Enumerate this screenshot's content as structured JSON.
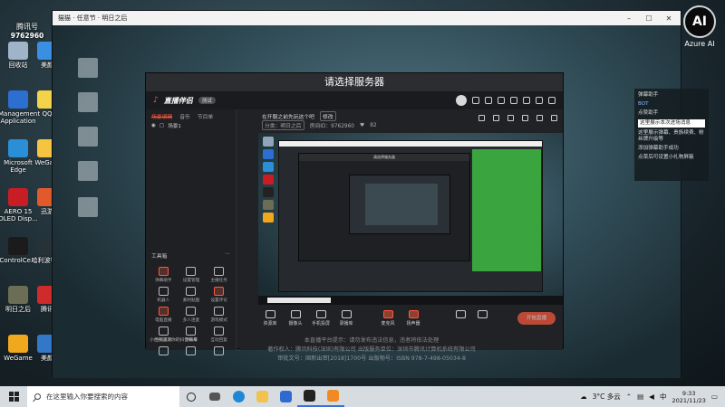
{
  "desktop_icons": [
    {
      "label": "回收站",
      "color": "#9fb4c8"
    },
    {
      "label": "Management Application",
      "color": "#2d6fd1"
    },
    {
      "label": "Microsoft Edge",
      "color": "#2a8fd6"
    },
    {
      "label": "AERO 15 OLED Disp...",
      "color": "#c81d25"
    },
    {
      "label": "ControlCe...",
      "color": "#1b1b1b"
    },
    {
      "label": "明日之后",
      "color": "#6b6d55"
    },
    {
      "label": "WeGame",
      "color": "#f0a81e"
    }
  ],
  "desktop_icons_col2": [
    {
      "label": "美颜",
      "color": "#3b8fe0"
    },
    {
      "label": "QQ",
      "color": "#f3d34a"
    },
    {
      "label": "WeGa...",
      "color": "#f5c542"
    },
    {
      "label": "迅游",
      "color": "#e05a2c"
    },
    {
      "label": "哈利波特...",
      "color": "#263238"
    },
    {
      "label": "腾讯",
      "color": "#cf2b2b"
    },
    {
      "label": "美颜",
      "color": "#3378c8"
    }
  ],
  "watermark": {
    "title": "腾讯号",
    "id": "9762960"
  },
  "right_logo": {
    "label": "Azure AI"
  },
  "video_window": {
    "title": "猫猫 · 任意节 · 明日之后"
  },
  "chat_panel": {
    "lines": [
      "弹幕助手",
      "BOT",
      "点赞助手",
      "这里展示本次进场消息",
      "这里展示弹幕、贵族续费、粉丝牌升级等",
      "添加弹幕助手成功",
      "点菜后可设置小礼物屏蔽"
    ]
  },
  "app": {
    "dialog_title": "请选择服务器",
    "logo": "直播伴侣",
    "logo_badge": "测试",
    "sidebar_tabs": [
      "场景编辑",
      "音乐",
      "节目单"
    ],
    "scene": "场景1",
    "tools_header": "工具箱",
    "tools": [
      "弹幕助手",
      "设置管理",
      "主播任务",
      "机器人",
      "素材贴图",
      "设置评论",
      "电脑直播",
      "多人连麦",
      "游戏模式",
      "连线互动",
      "弹幕库",
      "互动回复",
      "",
      "",
      ""
    ],
    "footer_note": "小色先请求你的抖音账号",
    "room": {
      "title": "在开服之前先玩这个吧",
      "edit": "修改",
      "tag": "分类：明日之后",
      "room_id": "房间ID：9762960",
      "fans": "82"
    },
    "bottom_tools": [
      "资源库",
      "摄像头",
      "手机投屏",
      "录播库",
      "麦克风",
      "扬声器",
      "",
      ""
    ],
    "live_button": "开始直播"
  },
  "overlay_text": [
    "本直播平台提示：请勿发布违法信息，违者将依法处理",
    "著作权人：腾讯科技(深圳)有限公司  出版服务单位：深圳市腾讯计算机系统有限公司",
    "审批文号：国新出审[2018]1700号  出版物号：ISBN 978-7-498-05034-8"
  ],
  "taskbar": {
    "search_placeholder": "在这里输入你要搜索的内容",
    "weather": "3°C 多云",
    "language": "中",
    "time": "9:33",
    "date": "2021/11/23"
  }
}
